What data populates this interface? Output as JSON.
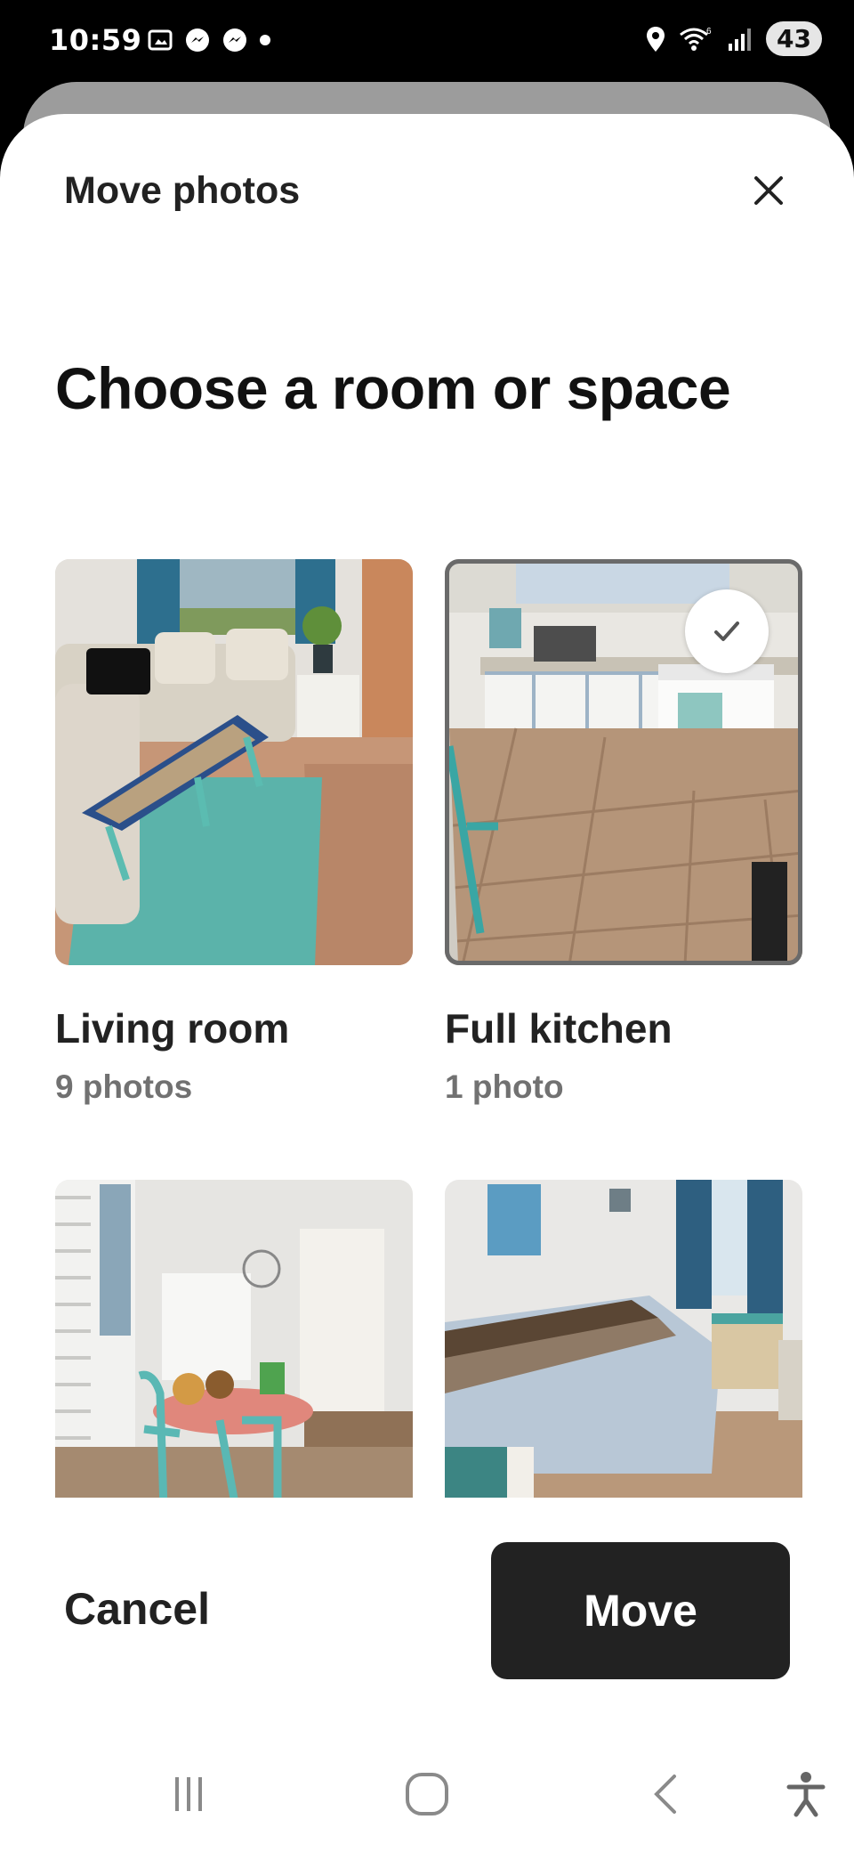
{
  "status_bar": {
    "time": "10:59",
    "battery": "43",
    "wifi_label": "6"
  },
  "sheet": {
    "title": "Move photos",
    "heading": "Choose a room or space"
  },
  "rooms": [
    {
      "name": "Living room",
      "count": "9 photos",
      "selected": false
    },
    {
      "name": "Full kitchen",
      "count": "1 photo",
      "selected": true
    },
    {
      "name": "",
      "count": "",
      "selected": false
    },
    {
      "name": "",
      "count": "",
      "selected": false
    }
  ],
  "actions": {
    "cancel_label": "Cancel",
    "move_label": "Move"
  },
  "colors": {
    "primary_button": "#222222",
    "secondary_text": "#717171",
    "selected_outline": "#6a6a6a"
  },
  "icons": {
    "close": "close-icon",
    "check": "check-icon",
    "nav_recent": "recent-apps-icon",
    "nav_home": "home-icon",
    "nav_back": "back-icon",
    "nav_accessibility": "accessibility-icon"
  }
}
